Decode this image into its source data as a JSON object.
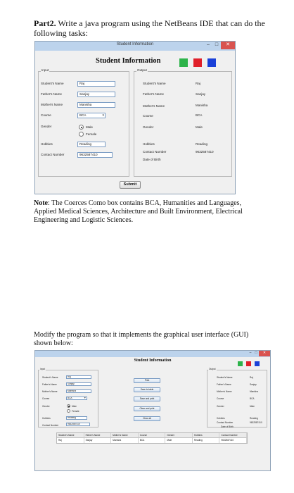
{
  "part": {
    "label": "Part2.",
    "text": "Write a java program using the NetBeans IDE that can do the following tasks:"
  },
  "window1": {
    "titlebar": "Student Information",
    "heading": "Student Information",
    "controls": {
      "minimize": "–",
      "maximize": "□",
      "close": "✕"
    },
    "squares": [
      "#2db34a",
      "#e0202a",
      "#1a40d8"
    ],
    "input_label": "Input",
    "output_label": "Output",
    "labels": {
      "student_name": "Student's Name",
      "father_name": "Father's Name",
      "mother_name": "Mother's Name",
      "course": "Course",
      "gender": "Gender",
      "hobbies": "Hobbies",
      "contact": "Contact Number",
      "dob": "Date of Birth"
    },
    "inputs": {
      "student_name": "Raj",
      "father_name": "Sanjay",
      "mother_name": "Manisha",
      "course": "BCA",
      "male": "Male",
      "female": "Female",
      "hobbies": "Reading",
      "contact": "9632587410"
    },
    "outputs": {
      "student_name": "Raj",
      "father_name": "Sanjay",
      "mother_name": "Manisha",
      "course": "BCA",
      "gender": "Male",
      "hobbies": "Reading",
      "contact": "9632587410"
    },
    "submit": "Submit"
  },
  "note": {
    "label": "Note",
    "text": ": The Coerces Como box contains BCA, Humanities and Languages, Applied Medical Sciences, Architecture and Built Environment, Electrical Engineering and Logistic Sciences."
  },
  "modify": {
    "text": "Modify the program so that it implements the graphical user interface (GUI) shown below:"
  },
  "window2": {
    "heading": "Student Information",
    "controls": {
      "minimize": "–",
      "maximize": "□",
      "close": "✕"
    },
    "squares": [
      "#2db34a",
      "#e0202a",
      "#1a40d8"
    ],
    "input_label": "Input",
    "output_label": "Output",
    "labels": {
      "student_name": "Student's Name",
      "father_name": "Father's Name",
      "mother_name": "Mother's Name",
      "course": "Course",
      "gender": "Gender",
      "hobbies": "Hobbies",
      "contact": "Contact Number",
      "dob": "Date of Birth"
    },
    "inputs": {
      "student_name": "Raj",
      "father_name": "Sanjay",
      "mother_name": "Manisha",
      "course": "BCA",
      "male": "Male",
      "female": "Female",
      "hobbies": "Reading",
      "contact": "9632587410"
    },
    "outputs": {
      "student_name": "Raj",
      "father_name": "Sanjay",
      "mother_name": "Manisha",
      "course": "BCA",
      "gender": "Male",
      "hobbies": "Reading",
      "contact": "9632587410"
    },
    "actions": [
      "Print",
      "Save to table",
      "Save and print",
      "Clear and print",
      "Clear all"
    ],
    "table": {
      "headers": [
        "Student's Name",
        "Father's Name",
        "Mother's Name",
        "Course",
        "Gender",
        "Hobbies",
        "Contact Number"
      ],
      "rows": [
        [
          "Raj",
          "Sanjay",
          "Manisha",
          "BCA",
          "Male",
          "Reading",
          "9632587410"
        ]
      ]
    }
  }
}
